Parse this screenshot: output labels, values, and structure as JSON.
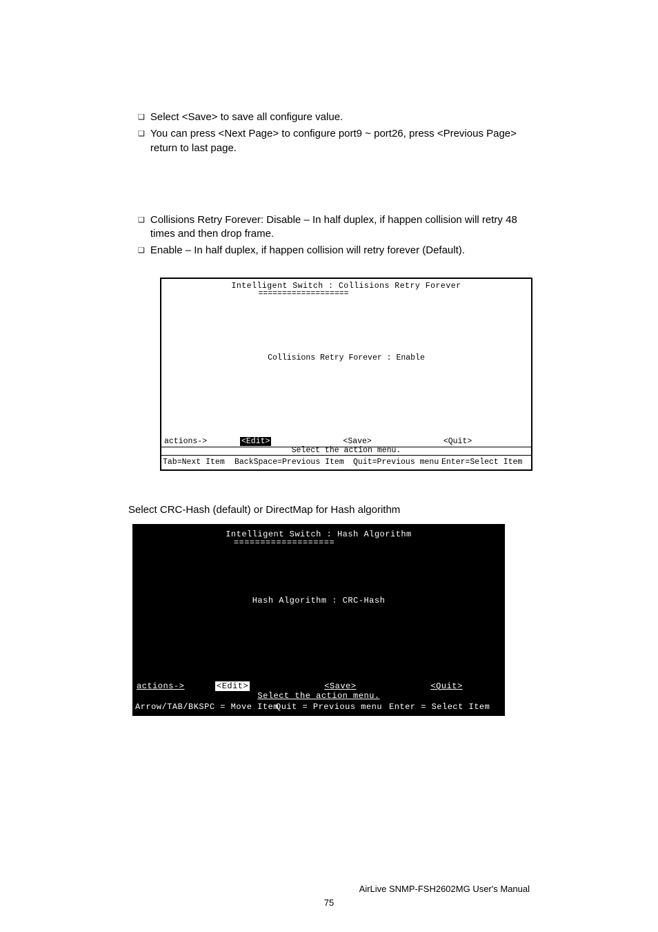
{
  "bullets1": {
    "item1": "Select <Save> to save all configure value.",
    "item2": "You can press <Next Page> to configure port9 ~ port26, press <Previous Page> return to last page."
  },
  "bullets2": {
    "item1": "Collisions Retry Forever: Disable – In half duplex, if happen collision will retry 48 times and then drop frame.",
    "item2": "Enable – In half duplex, if happen collision will retry forever (Default)."
  },
  "terminal1": {
    "title": "Intelligent Switch : Collisions Retry Forever",
    "underline": "===================",
    "setting": "Collisions Retry Forever : Enable",
    "actionsLabel": "actions->",
    "edit": "<Edit>",
    "save": "<Save>",
    "quit": "<Quit>",
    "msg": "Select the action menu.",
    "help1": "Tab=Next Item",
    "help2": "BackSpace=Previous Item",
    "help3": "Quit=Previous menu",
    "help4": "Enter=Select Item"
  },
  "midText": "Select CRC-Hash (default) or DirectMap for Hash algorithm",
  "terminal2": {
    "title": "Intelligent Switch : Hash Algorithm",
    "underline": "===================",
    "setting": "Hash Algorithm : CRC-Hash",
    "actionsLabel": "actions->",
    "edit": "<Edit>",
    "save": "<Save>",
    "quit": "<Quit>",
    "msg": "Select the action menu.",
    "help1": "Arrow/TAB/BKSPC = Move Item",
    "help2": "Quit = Previous menu",
    "help3": "Enter = Select Item"
  },
  "footer": {
    "doc": "AirLive SNMP-FSH2602MG User's Manual",
    "page": "75"
  }
}
